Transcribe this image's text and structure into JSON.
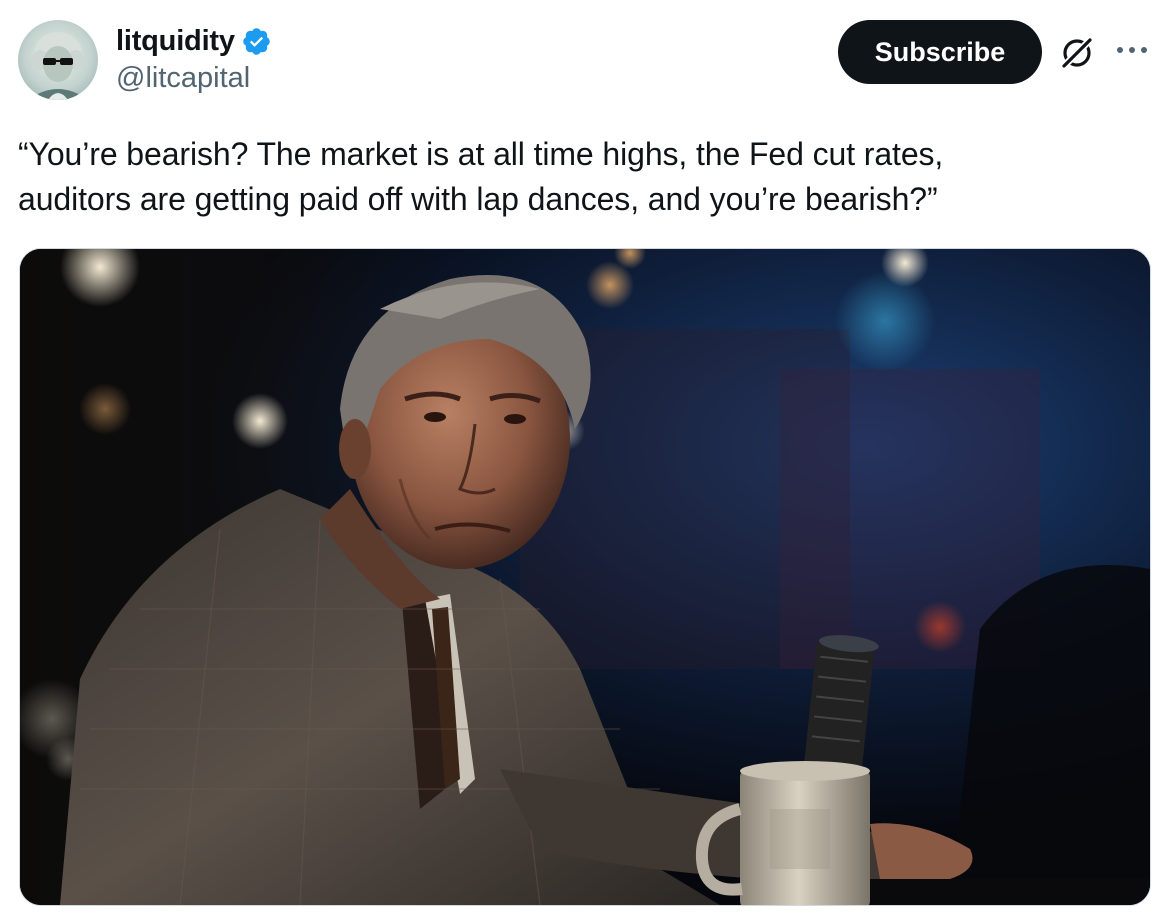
{
  "tweet": {
    "author": {
      "display_name": "litquidity",
      "handle": "@litcapital",
      "verified": true,
      "verified_color": "#1d9bf0"
    },
    "actions": {
      "subscribe_label": "Subscribe",
      "grok_icon": "grok-icon",
      "more_icon": "more-icon"
    },
    "text_line_1": "“You’re bearish? The market is at all time highs, the Fed cut rates,",
    "text_line_2": "auditors are getting paid off with lap dances, and you’re bearish?”",
    "media": {
      "type": "image"
    }
  },
  "colors": {
    "text_primary": "#0f1419",
    "text_secondary": "#536471",
    "button_bg": "#0f1419",
    "button_text": "#ffffff",
    "border": "#cfd9de"
  }
}
